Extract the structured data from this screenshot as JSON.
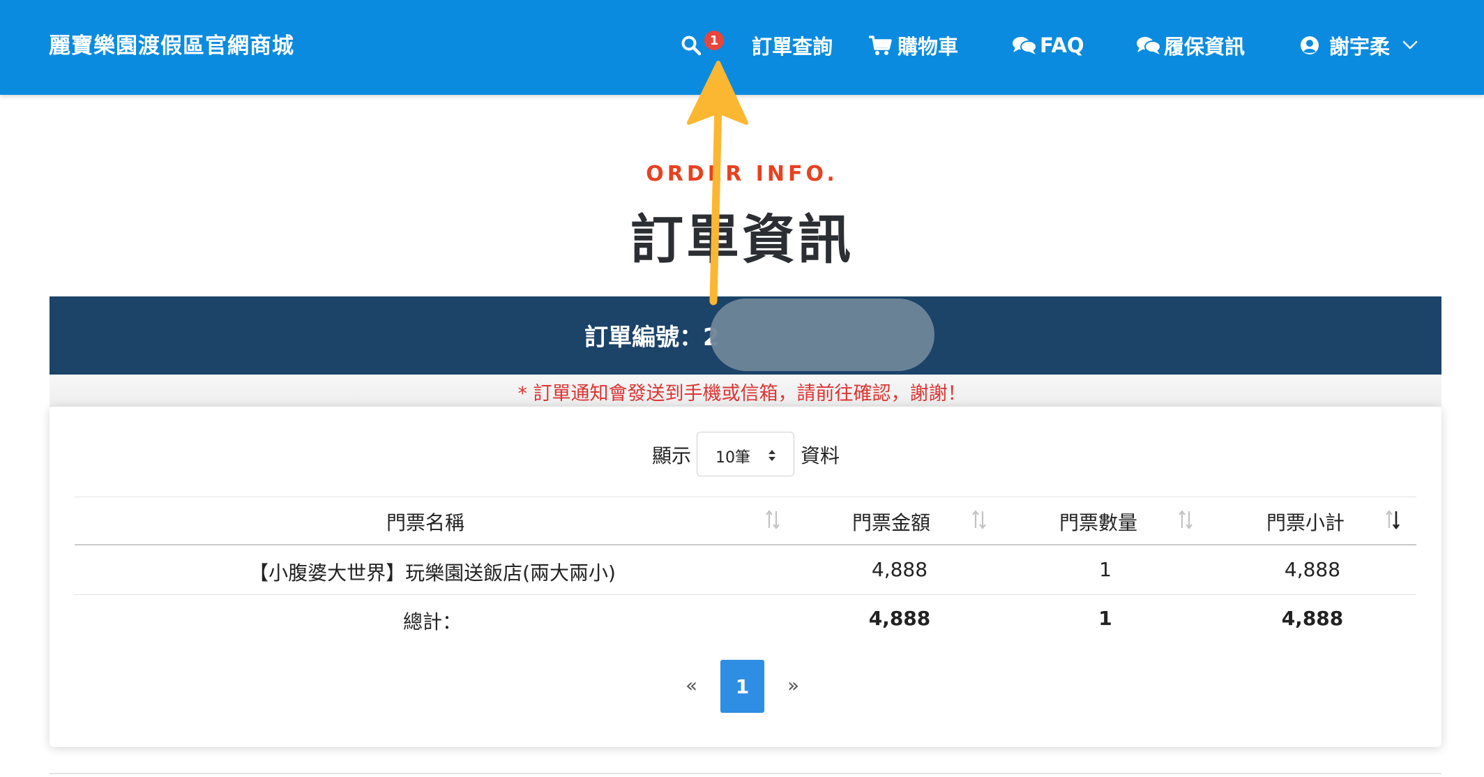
{
  "header": {
    "brand": "麗寶樂園渡假區官網商城",
    "nav": {
      "order_lookup": "訂單查詢",
      "order_badge": "1",
      "cart": "購物車",
      "faq": "FAQ",
      "warranty": "履保資訊",
      "user": "謝宇柔"
    }
  },
  "page": {
    "subtitle": "ORDER INFO.",
    "title": "訂單資訊",
    "order_label": "訂單編號：2",
    "notice": "* 訂單通知會發送到手機或信箱，請前往確認，謝謝！"
  },
  "table_controls": {
    "show_label": "顯示",
    "page_size": "10筆",
    "records_label": "資料"
  },
  "table": {
    "columns": [
      "門票名稱",
      "門票金額",
      "門票數量",
      "門票小計"
    ],
    "rows": [
      [
        "【小腹婆大世界】玩樂園送飯店(兩大兩小)",
        "4,888",
        "1",
        "4,888"
      ]
    ],
    "total": [
      "總計：",
      "4,888",
      "1",
      "4,888"
    ]
  },
  "pagination": {
    "prev": "«",
    "current": "1",
    "next": "»"
  },
  "colors": {
    "header_bg": "#0b8bdf",
    "order_bar_bg": "#1c4368",
    "accent_red": "#e8411f",
    "notice_red": "#dc3535",
    "page_active": "#2e8ee4",
    "annotation_arrow": "#fbb731"
  },
  "icons": {
    "search": "search-icon",
    "cart": "cart-icon",
    "faq": "chat-bubbles-icon",
    "warranty": "chat-bubbles-icon",
    "user": "user-circle-icon",
    "dropdown": "chevron-down-icon"
  }
}
